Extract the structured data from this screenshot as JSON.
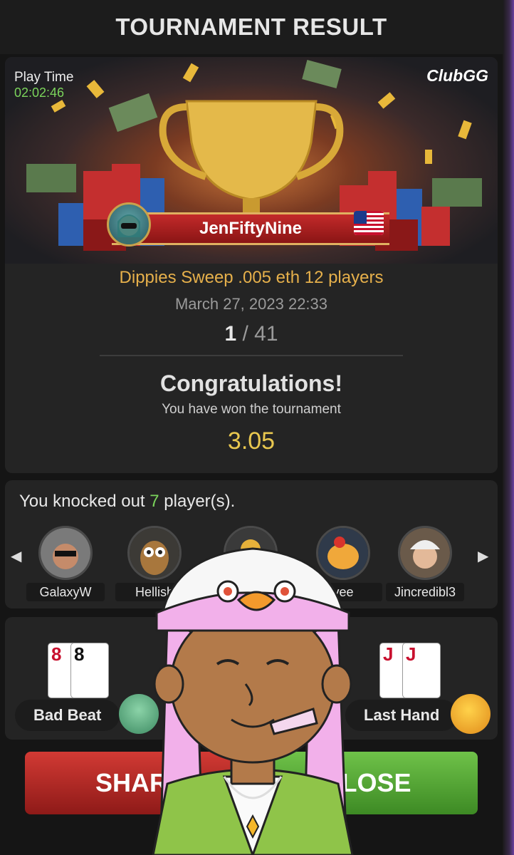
{
  "header": {
    "title": "TOURNAMENT RESULT"
  },
  "hero": {
    "play_time_label": "Play Time",
    "play_time_value": "02:02:46",
    "logo": "ClubGG",
    "player_name": "JenFiftyNine",
    "flag_icon": "us-flag-icon",
    "tournament_name": "Dippies Sweep .005 eth 12 players",
    "date": "March 27, 2023 22:33",
    "place": "1",
    "total": " / 41",
    "congrats": "Congratulations!",
    "subtitle": "You have won the tournament",
    "prize": "3.05"
  },
  "knockouts": {
    "prefix": "You knocked out ",
    "count": "7",
    "suffix": " player(s).",
    "players": [
      {
        "name": "GalaxyW"
      },
      {
        "name": "Hellish"
      },
      {
        "name": ""
      },
      {
        "name": "vee"
      },
      {
        "name": "Jincredibl3"
      }
    ]
  },
  "hands": {
    "bad_beat_label": "Bad Beat",
    "bad_beat_cards": [
      "8",
      "8"
    ],
    "last_hand_label": "Last Hand",
    "last_hand_cards": [
      "J",
      "J"
    ]
  },
  "buttons": {
    "share": "SHAR",
    "close": "LOSE"
  },
  "colors": {
    "green": "#7bd45b",
    "gold": "#e8c74f",
    "share_red": "#c7322d",
    "close_green": "#5fae3c"
  }
}
